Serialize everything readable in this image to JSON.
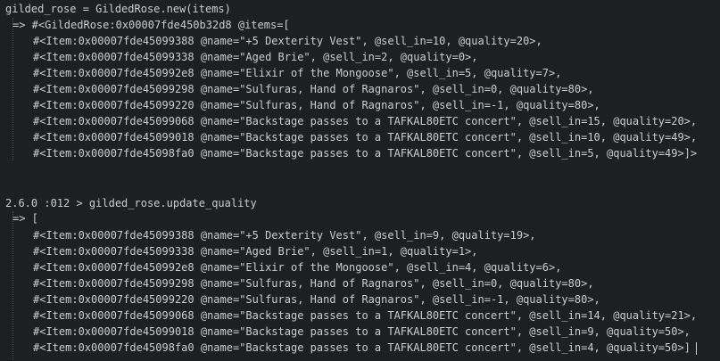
{
  "block1": {
    "command": "gilded_rose = GildedRose.new(items)",
    "result_header": "=> #<GildedRose:0x00007fde450b32d8 @items=[",
    "items": [
      "#<Item:0x00007fde45099388 @name=\"+5 Dexterity Vest\", @sell_in=10, @quality=20>,",
      "#<Item:0x00007fde45099338 @name=\"Aged Brie\", @sell_in=2, @quality=0>,",
      "#<Item:0x00007fde450992e8 @name=\"Elixir of the Mongoose\", @sell_in=5, @quality=7>,",
      "#<Item:0x00007fde45099298 @name=\"Sulfuras, Hand of Ragnaros\", @sell_in=0, @quality=80>,",
      "#<Item:0x00007fde45099220 @name=\"Sulfuras, Hand of Ragnaros\", @sell_in=-1, @quality=80>,",
      "#<Item:0x00007fde45099068 @name=\"Backstage passes to a TAFKAL80ETC concert\", @sell_in=15, @quality=20>,",
      "#<Item:0x00007fde45099018 @name=\"Backstage passes to a TAFKAL80ETC concert\", @sell_in=10, @quality=49>,",
      "#<Item:0x00007fde45098fa0 @name=\"Backstage passes to a TAFKAL80ETC concert\", @sell_in=5, @quality=49>]>"
    ]
  },
  "block2": {
    "prompt": "2.6.0 :012 > gilded_rose.update_quality",
    "result_header": "=> [",
    "items": [
      "#<Item:0x00007fde45099388 @name=\"+5 Dexterity Vest\", @sell_in=9, @quality=19>,",
      "#<Item:0x00007fde45099338 @name=\"Aged Brie\", @sell_in=1, @quality=1>,",
      "#<Item:0x00007fde450992e8 @name=\"Elixir of the Mongoose\", @sell_in=4, @quality=6>,",
      "#<Item:0x00007fde45099298 @name=\"Sulfuras, Hand of Ragnaros\", @sell_in=0, @quality=80>,",
      "#<Item:0x00007fde45099220 @name=\"Sulfuras, Hand of Ragnaros\", @sell_in=-1, @quality=80>,",
      "#<Item:0x00007fde45099068 @name=\"Backstage passes to a TAFKAL80ETC concert\", @sell_in=14, @quality=21>,",
      "#<Item:0x00007fde45099018 @name=\"Backstage passes to a TAFKAL80ETC concert\", @sell_in=9, @quality=50>,",
      "#<Item:0x00007fde45098fa0 @name=\"Backstage passes to a TAFKAL80ETC concert\", @sell_in=4, @quality=50>]"
    ]
  }
}
